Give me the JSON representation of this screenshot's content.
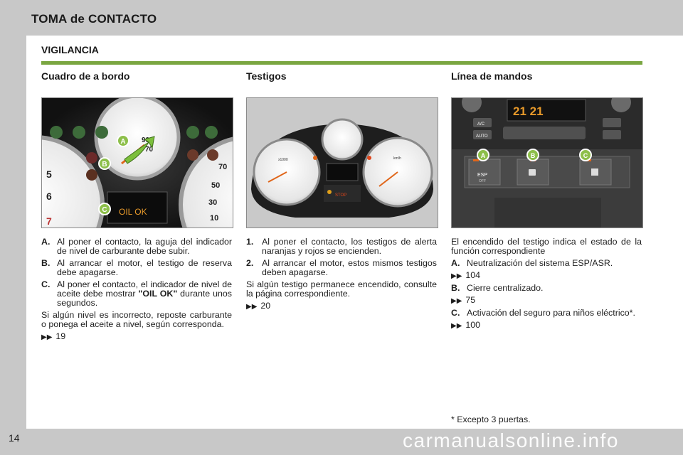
{
  "header": {
    "title": "TOMA de CONTACTO"
  },
  "section": {
    "title": "VIGILANCIA"
  },
  "columns": {
    "cuadro": {
      "heading": "Cuadro de a bordo",
      "items": [
        {
          "label": "A.",
          "text": "Al poner el contacto, la aguja del indicador de nivel de carburante debe subir."
        },
        {
          "label": "B.",
          "text": "Al arrancar el motor, el testigo de reserva debe apagarse."
        },
        {
          "label": "C.",
          "text_before": "Al poner el contacto, el indicador de nivel de aceite debe mostrar ",
          "text_bold": "\"OIL OK\"",
          "text_after": " durante unos segundos."
        }
      ],
      "para": "Si algún nivel es incorrecto, reposte carburante o ponega el aceite a nivel, según corresponda.",
      "ref": "19",
      "gauge_labels": {
        "g5": "5",
        "g6": "6",
        "g7": "7",
        "r70": "70",
        "r50": "50",
        "r30": "30",
        "r10": "10",
        "n90": "90",
        "n70": "70"
      },
      "callouts": [
        "A",
        "B",
        "C"
      ],
      "oil_display": "OIL OK"
    },
    "testigos": {
      "heading": "Testigos",
      "items": [
        {
          "label": "1.",
          "text": "Al poner el contacto, los testigos de alerta naranjas y rojos se encienden."
        },
        {
          "label": "2.",
          "text": "Al arrancar el motor, estos mismos testigos deben apagarse."
        }
      ],
      "para": "Si algún testigo permanece encendido, consulte la página correspondiente.",
      "ref": "20",
      "gauge_labels": {
        "rpm": "x1000",
        "kmh": "km/h",
        "stop": "STOP"
      }
    },
    "mandos": {
      "heading": "Línea de mandos",
      "intro": "El encendido del testigo indica el estado de la función correspondiente",
      "entries": [
        {
          "label": "A.",
          "text": "Neutralización del sistema ESP/ASR.",
          "ref": "104"
        },
        {
          "label": "B.",
          "text": "Cierre centralizado.",
          "ref": "75"
        },
        {
          "label": "C.",
          "text": "Activación del seguro para niños eléctrico*.",
          "ref": "100"
        }
      ],
      "footnote": "* Excepto 3 puertas.",
      "panel": {
        "display": "21   21",
        "ac": "A/C",
        "auto": "AUTO",
        "esp": "ESP",
        "off": "OFF"
      },
      "callouts": [
        "A",
        "B",
        "C"
      ]
    }
  },
  "footer": {
    "page_number": "14",
    "watermark": "carmanualsonline.info"
  },
  "colors": {
    "accent": "#7aa641",
    "callout_green": "#8dbf4a",
    "page_bg": "#ffffff",
    "band_bg": "#c8c8c8"
  }
}
